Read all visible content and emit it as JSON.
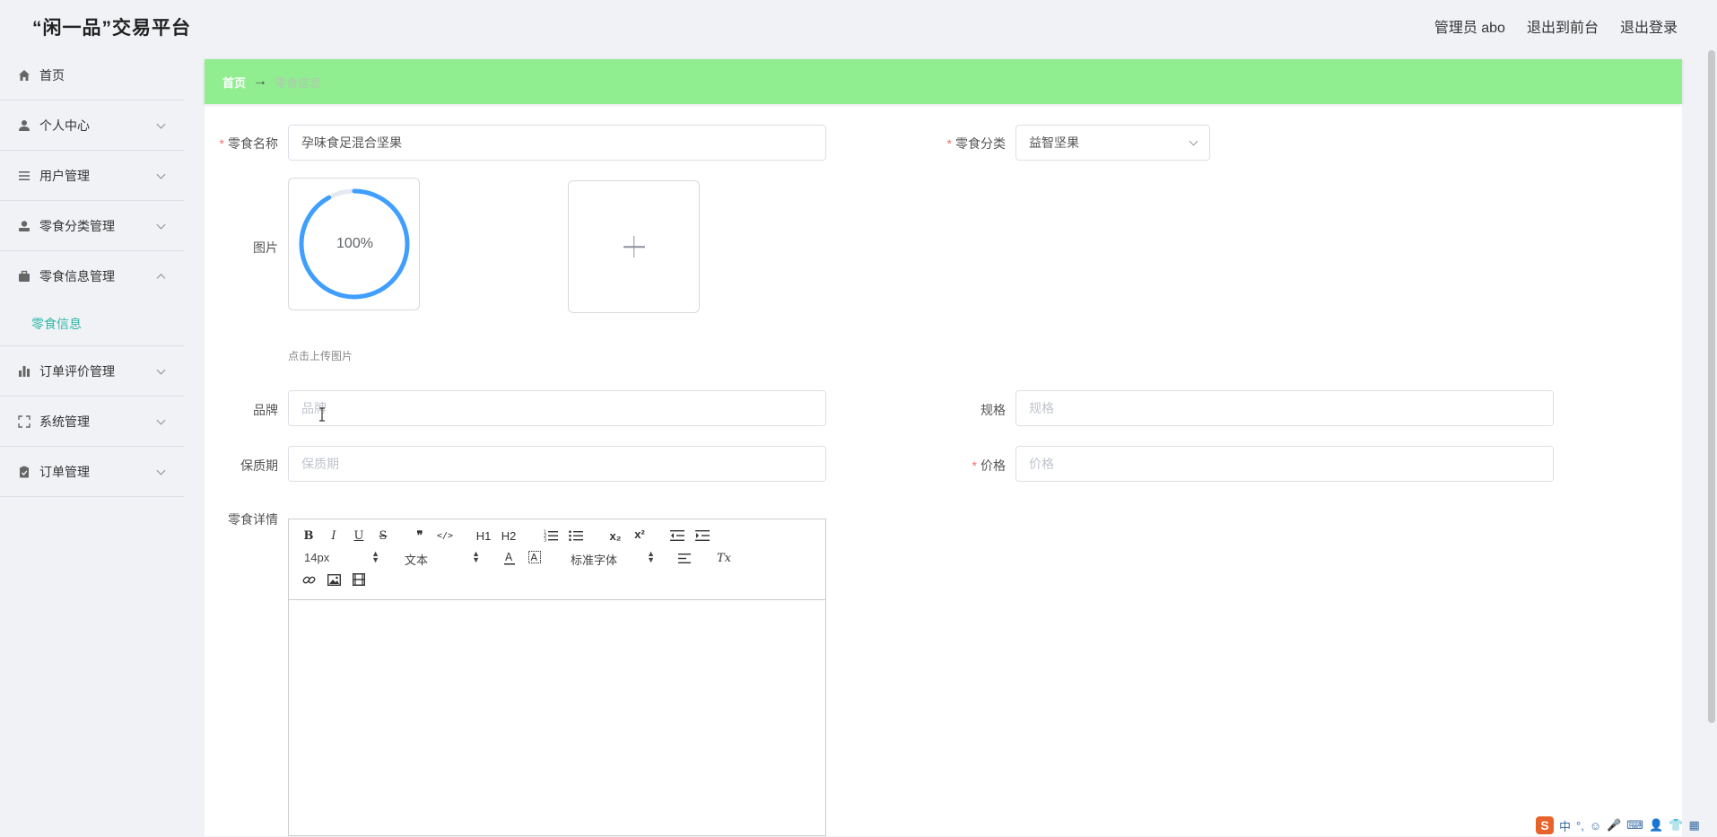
{
  "header": {
    "app_title": "“闲一品”交易平台",
    "admin_label": "管理员 abo",
    "to_frontend": "退出到前台",
    "logout": "退出登录"
  },
  "sidebar": {
    "items": [
      {
        "label": "首页",
        "icon": "home-icon"
      },
      {
        "label": "个人中心",
        "icon": "user-icon"
      },
      {
        "label": "用户管理",
        "icon": "list-icon"
      },
      {
        "label": "零食分类管理",
        "icon": "user-solid-icon"
      },
      {
        "label": "零食信息管理",
        "icon": "briefcase-icon"
      },
      {
        "label": "订单评价管理",
        "icon": "bar-chart-icon"
      },
      {
        "label": "系统管理",
        "icon": "fullscreen-icon"
      },
      {
        "label": "订单管理",
        "icon": "clipboard-icon"
      }
    ],
    "submenu_active": "零食信息"
  },
  "breadcrumb": {
    "home": "首页",
    "arrow": "→",
    "current": "零食信息"
  },
  "form": {
    "name_label": "零食名称",
    "name_value": "孕味食足混合坚果",
    "category_label": "零食分类",
    "category_value": "益智坚果",
    "image_label": "图片",
    "upload_progress": "100%",
    "upload_tip": "点击上传图片",
    "brand_label": "品牌",
    "brand_placeholder": "品牌",
    "spec_label": "规格",
    "spec_placeholder": "规格",
    "shelf_label": "保质期",
    "shelf_placeholder": "保质期",
    "price_label": "价格",
    "price_placeholder": "价格",
    "detail_label": "零食详情"
  },
  "editor": {
    "font_size": "14px",
    "header_select": "文本",
    "font_family": "标准字体",
    "buttons": {
      "bold": "B",
      "italic": "I",
      "underline": "U",
      "strike": "S",
      "blockquote": "❞",
      "code": "</>",
      "h1": "H1",
      "h2": "H2",
      "sub": "x₂",
      "sup": "x²",
      "clean": "Tx"
    }
  },
  "ime": {
    "logo": "S",
    "lang": "中",
    "punct": "°,"
  },
  "colors": {
    "breadcrumb_bg": "#90ee90",
    "accent": "#2fb8a7",
    "progress": "#409eff",
    "required": "#f56c6c"
  }
}
